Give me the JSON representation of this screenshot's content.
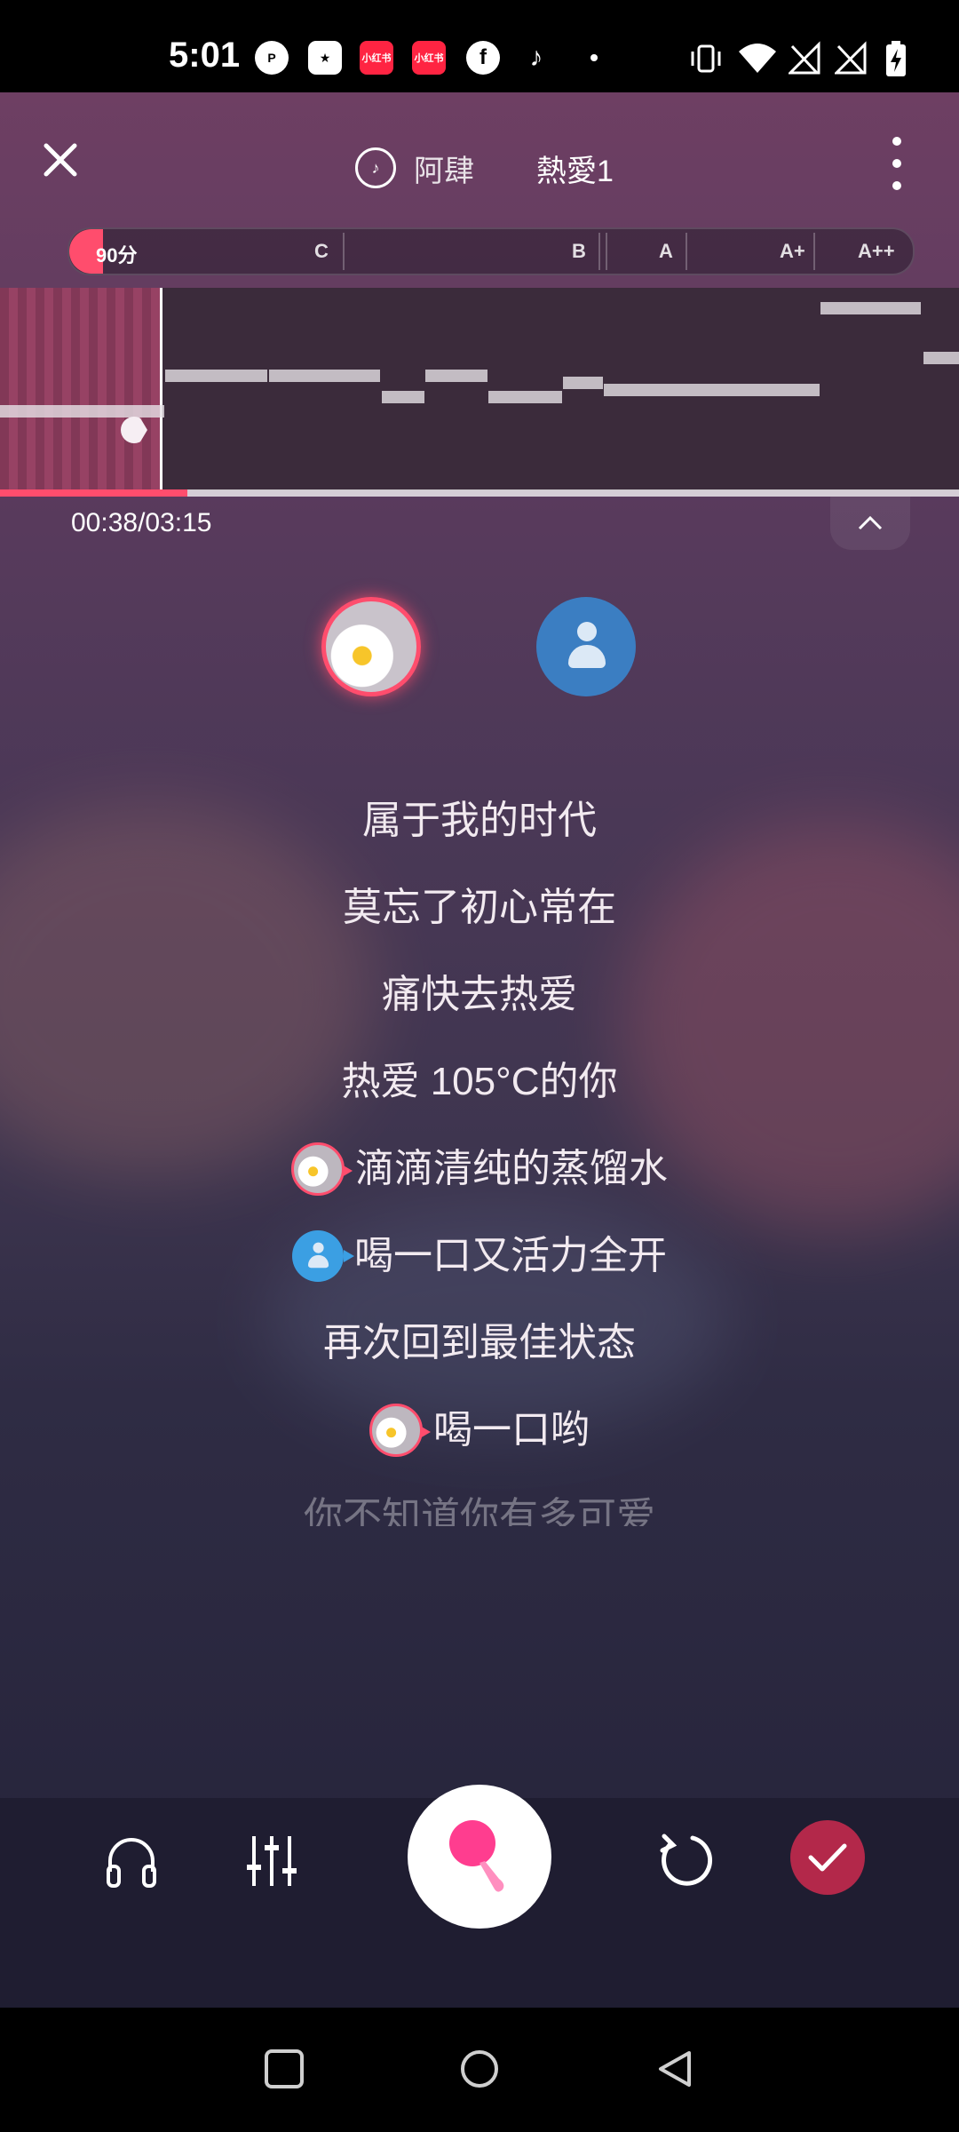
{
  "status_bar": {
    "time": "5:01",
    "notification_icons": [
      "p-icon",
      "star-icon",
      "xiaohongshu-icon",
      "xiaohongshu-icon",
      "facebook-icon",
      "tiktok-icon",
      "dot-icon"
    ],
    "xhs_label": "小红书",
    "right_icons": [
      "vibrate-icon",
      "wifi-icon",
      "no-signal-icon",
      "no-signal-icon",
      "battery-charging-icon"
    ]
  },
  "header": {
    "artist": "阿肆",
    "song_title": "熱愛1",
    "more_icon": "more-vertical-icon",
    "close_icon": "close-icon"
  },
  "score": {
    "value_label": "90分",
    "grades": [
      "C",
      "B",
      "A",
      "A+",
      "A++"
    ],
    "fill_fraction": 0.04
  },
  "playback": {
    "time": "00:38/03:15",
    "progress_fraction": 0.195
  },
  "singers": [
    {
      "name": "singer-a",
      "active": true
    },
    {
      "name": "singer-b",
      "active": false
    }
  ],
  "lyrics": [
    {
      "text": "属于我的时代",
      "singer": null
    },
    {
      "text": "莫忘了初心常在",
      "singer": null
    },
    {
      "text": "痛快去热爱",
      "singer": null
    },
    {
      "text": "热爱 105°C的你",
      "singer": null
    },
    {
      "text": "滴滴清纯的蒸馏水",
      "singer": "a"
    },
    {
      "text": "喝一口又活力全开",
      "singer": "b"
    },
    {
      "text": "再次回到最佳状态",
      "singer": null
    },
    {
      "text": "喝一口哟",
      "singer": "a"
    },
    {
      "text": "你不知道你有多可爱",
      "singer": null
    }
  ],
  "controls": {
    "headphones_icon": "headphones-icon",
    "mixer_icon": "equalizer-icon",
    "record_icon": "microphone-icon",
    "retry_icon": "refresh-icon",
    "done_icon": "check-icon"
  },
  "colors": {
    "accent": "#ff4d6d",
    "done": "#b3284a",
    "singer_b": "#3b7ec2"
  }
}
